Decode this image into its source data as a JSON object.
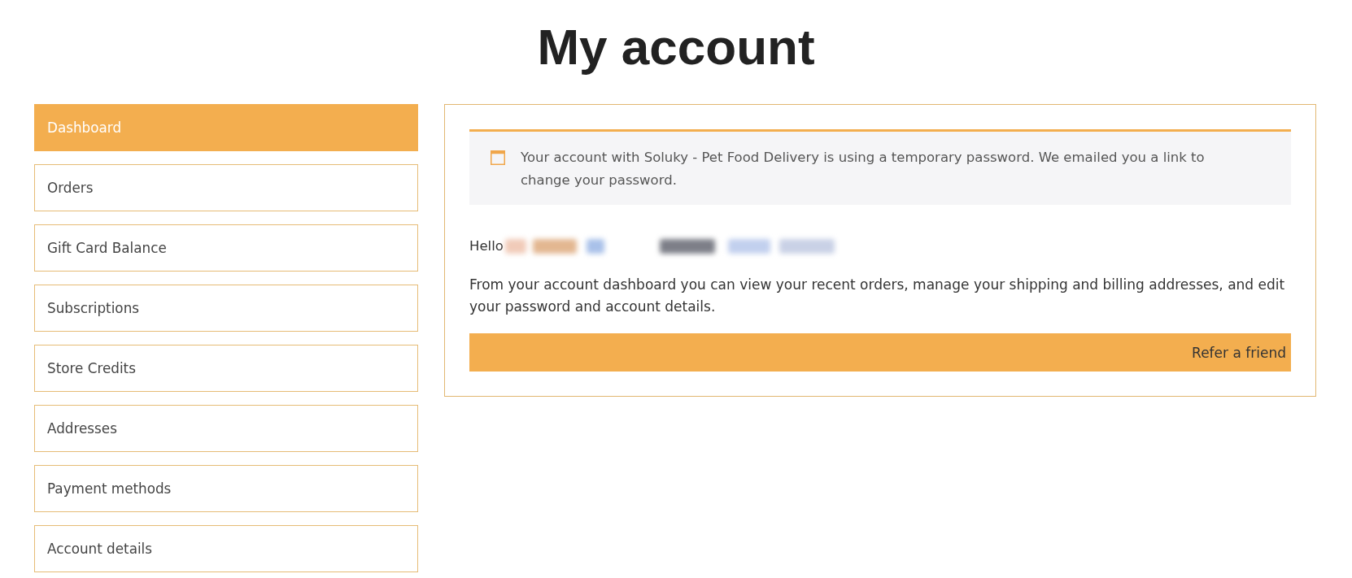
{
  "page": {
    "title": "My account"
  },
  "sidebar": {
    "items": [
      {
        "label": "Dashboard",
        "selected": true
      },
      {
        "label": "Orders",
        "selected": false
      },
      {
        "label": "Gift Card Balance",
        "selected": false
      },
      {
        "label": "Subscriptions",
        "selected": false
      },
      {
        "label": "Store Credits",
        "selected": false
      },
      {
        "label": "Addresses",
        "selected": false
      },
      {
        "label": "Payment methods",
        "selected": false
      },
      {
        "label": "Account details",
        "selected": false
      }
    ]
  },
  "notice": {
    "text": "Your account with Soluky - Pet Food Delivery is using a temporary password. We emailed you a link to change your password."
  },
  "greeting": {
    "text": "Hello",
    "name_blurred": true
  },
  "intro": {
    "text": "From your account dashboard you can view your recent orders, manage your shipping and billing addresses, and edit your password and account details."
  },
  "refer_button": {
    "label": "Refer a friend"
  }
}
